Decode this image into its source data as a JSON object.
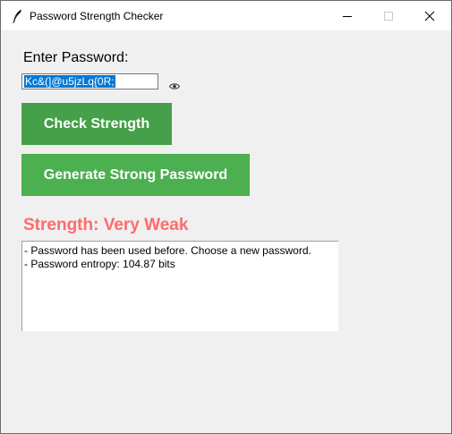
{
  "window": {
    "title": "Password Strength Checker"
  },
  "form": {
    "enter_label": "Enter Password:",
    "password_value": "Kc&(]@u5jzLq{0R;",
    "show_password_icon": "eye-icon"
  },
  "buttons": {
    "check_label": "Check Strength",
    "generate_label": "Generate Strong Password"
  },
  "result": {
    "strength_label": "Strength: Very Weak",
    "lines": [
      "- Password has been used before. Choose a new password.",
      "- Password entropy: 104.87 bits"
    ]
  },
  "colors": {
    "button_green": "#4caf50",
    "strength_red": "#ff6b6b",
    "selection_blue": "#0078d7"
  }
}
